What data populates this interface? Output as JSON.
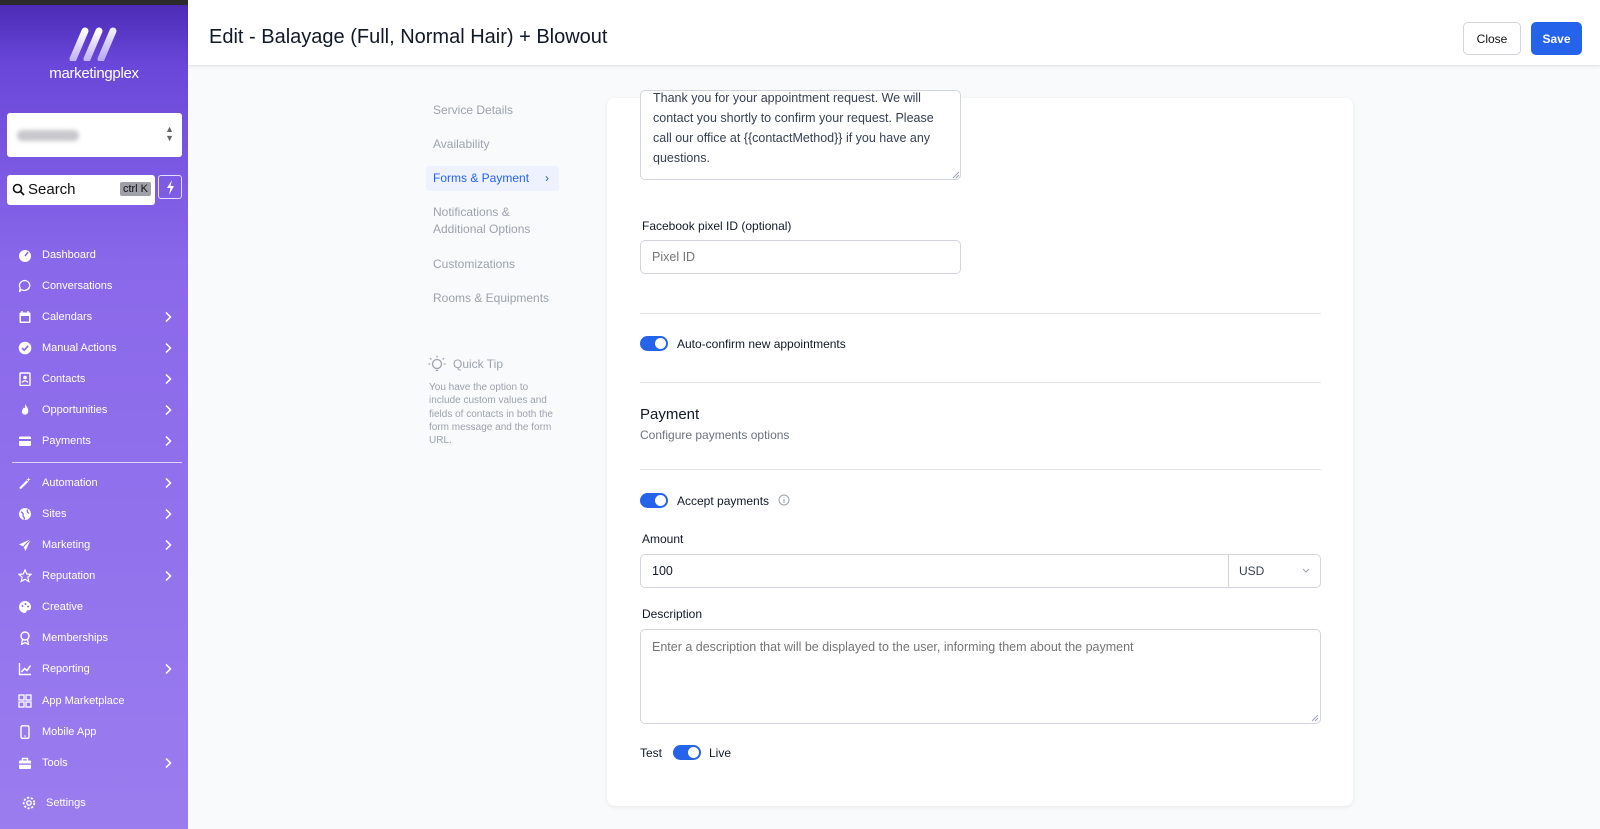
{
  "brand": {
    "name": "marketingplex"
  },
  "account": {
    "value": ""
  },
  "search": {
    "label": "Search",
    "shortcut": "ctrl K"
  },
  "nav": {
    "items": [
      {
        "label": "Dashboard",
        "icon": "dashboard-icon",
        "chevron": false
      },
      {
        "label": "Conversations",
        "icon": "chat-bubble-icon",
        "chevron": false
      },
      {
        "label": "Calendars",
        "icon": "calendar-icon",
        "chevron": true
      },
      {
        "label": "Manual Actions",
        "icon": "check-badge-icon",
        "chevron": true
      },
      {
        "label": "Contacts",
        "icon": "contact-card-icon",
        "chevron": true
      },
      {
        "label": "Opportunities",
        "icon": "flame-icon",
        "chevron": true
      },
      {
        "label": "Payments",
        "icon": "credit-card-icon",
        "chevron": true
      },
      {
        "label": "Automation",
        "icon": "magic-wand-icon",
        "chevron": true
      },
      {
        "label": "Sites",
        "icon": "globe-icon",
        "chevron": true
      },
      {
        "label": "Marketing",
        "icon": "paper-plane-icon",
        "chevron": true
      },
      {
        "label": "Reputation",
        "icon": "star-icon",
        "chevron": true
      },
      {
        "label": "Creative",
        "icon": "palette-icon",
        "chevron": false
      },
      {
        "label": "Memberships",
        "icon": "award-icon",
        "chevron": false
      },
      {
        "label": "Reporting",
        "icon": "chart-icon",
        "chevron": true
      },
      {
        "label": "App Marketplace",
        "icon": "grid-icon",
        "chevron": false
      },
      {
        "label": "Mobile App",
        "icon": "phone-icon",
        "chevron": false
      },
      {
        "label": "Tools",
        "icon": "toolbox-icon",
        "chevron": true
      }
    ],
    "settings": {
      "label": "Settings",
      "icon": "gear-icon"
    }
  },
  "header": {
    "title": "Edit - Balayage (Full, Normal Hair) + Blowout",
    "close_label": "Close",
    "save_label": "Save"
  },
  "subnav": {
    "items": [
      {
        "label": "Service Details",
        "active": false
      },
      {
        "label": "Availability",
        "active": false
      },
      {
        "label": "Forms & Payment",
        "active": true
      },
      {
        "label": "Notifications & Additional Options",
        "active": false
      },
      {
        "label": "Customizations",
        "active": false
      },
      {
        "label": "Rooms & Equipments",
        "active": false
      }
    ]
  },
  "tip": {
    "title": "Quick Tip",
    "body": "You have the option to include custom values and fields of contacts in both the form message and the form URL."
  },
  "form": {
    "confirmation_message": "Thank you for your appointment request. We will contact you shortly to confirm your request. Please call our office at {{contactMethod}} if you have any questions.",
    "pixel_label": "Facebook pixel ID (optional)",
    "pixel_placeholder": "Pixel ID",
    "auto_confirm_label": "Auto-confirm new appointments",
    "auto_confirm_on": true,
    "payment_title": "Payment",
    "payment_subtitle": "Configure payments options",
    "accept_payments_label": "Accept payments",
    "accept_payments_on": true,
    "amount_label": "Amount",
    "amount_value": "100",
    "currency": "USD",
    "description_label": "Description",
    "description_placeholder": "Enter a description that will be displayed to the user, informing them about the payment",
    "mode_test_label": "Test",
    "mode_live_label": "Live",
    "mode_live_on": true
  },
  "colors": {
    "accent": "#2563eb",
    "sidebar_top": "#4c2bb6",
    "sidebar_bottom": "#9b7def"
  }
}
